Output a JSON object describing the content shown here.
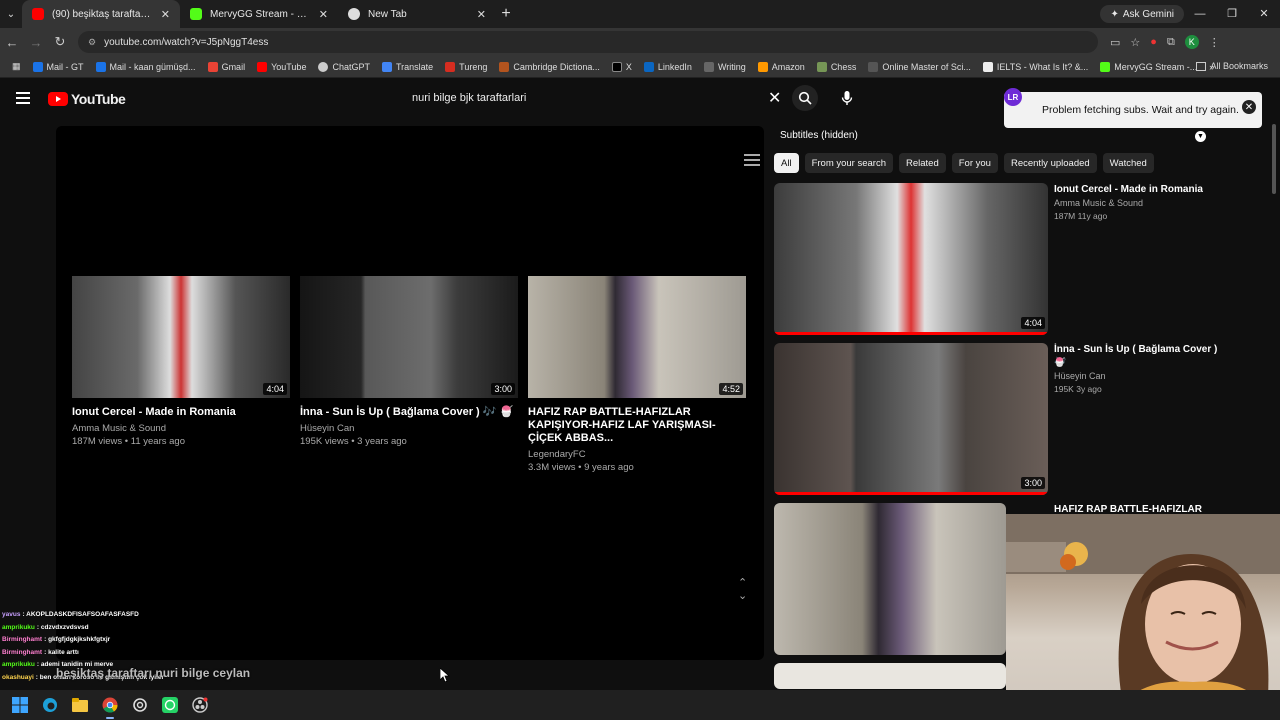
{
  "browser": {
    "tabs": [
      {
        "title": "(90) beşiktaş taraftarı nuri bilge",
        "active": true,
        "favicon_color": "#ff0000"
      },
      {
        "title": "MervyGG Stream - Watch Live",
        "active": false,
        "favicon_color": "#53fc18"
      },
      {
        "title": "New Tab",
        "active": false,
        "favicon_color": "#dddddd"
      }
    ],
    "gemini_label": "Ask Gemini",
    "url": "youtube.com/watch?v=J5pNggT4ess",
    "bookmarks": [
      "Mail - GT",
      "Mail - kaan gümüşd...",
      "Gmail",
      "YouTube",
      "ChatGPT",
      "Translate",
      "Tureng",
      "Cambridge Dictiona...",
      "X",
      "LinkedIn",
      "Writing",
      "Amazon",
      "Chess",
      "Online Master of Sci...",
      "IELTS - What Is It? &...",
      "MervyGG Stream -..."
    ],
    "all_bookmarks": "All Bookmarks",
    "profile_letter": "K"
  },
  "youtube": {
    "logo": "YouTube",
    "search_query": "nuri bilge bjk taraftarlari",
    "toast": {
      "badge": "LR",
      "message": "Problem fetching subs. Wait and try again."
    },
    "endscreen": [
      {
        "title": "Ionut Cercel - Made in Romania",
        "channel": "Amma Music & Sound",
        "meta": "187M views • 11 years ago",
        "duration": "4:04"
      },
      {
        "title": "İnna - Sun İs Up ( Bağlama Cover ) 🎶 🍧",
        "channel": "Hüseyin Can",
        "meta": "195K views • 3 years ago",
        "duration": "3:00"
      },
      {
        "title": "HAFIZ RAP BATTLE-HAFIZLAR KAPIŞIYOR-HAFIZ LAF YARIŞMASI-ÇİÇEK ABBAS...",
        "channel": "LegendaryFC",
        "meta": "3.3M views • 9 years ago",
        "duration": "4:52"
      }
    ],
    "sidebar": {
      "subtitles_label": "Subtitles (hidden)",
      "chips": [
        "All",
        "From your search",
        "Related",
        "For you",
        "Recently uploaded",
        "Watched"
      ],
      "items": [
        {
          "title": "Ionut Cercel - Made in Romania",
          "channel": "Amma Music & Sound",
          "meta": "187M  11y ago",
          "duration": "4:04"
        },
        {
          "title": "İnna - Sun İs Up ( Bağlama Cover ) 🎶",
          "title2": "🍧",
          "channel": "Hüseyin Can",
          "meta": "195K  3y ago",
          "duration": "3:00"
        },
        {
          "title": "HAFIZ RAP BATTLE-HAFIZLAR",
          "channel": "",
          "meta": "",
          "duration": ""
        }
      ]
    },
    "caption": "beşiktaş taraftarı nuri bilge ceylan"
  },
  "chat": [
    {
      "user": "yavus",
      "color": "#c8a0ff",
      "text": "AKOPLDASKDFISAFSOAFASFASFD"
    },
    {
      "user": "amprikuku",
      "color": "#53fc18",
      "text": "cdzvdxzvdsvsd"
    },
    {
      "user": "Birminghamt",
      "color": "#ff7fd0",
      "text": "gkfgfjdgkjkshkfgtxjr"
    },
    {
      "user": "Birminghamt",
      "color": "#ff7fd0",
      "text": "kalite arttı"
    },
    {
      "user": "amprikuku",
      "color": "#53fc18",
      "text": "ademi tanidin mi merve"
    },
    {
      "user": "okashuayi",
      "color": "#ffd54f",
      "text": "ben onları koroso ile gitmiştim çok iyiler"
    }
  ]
}
